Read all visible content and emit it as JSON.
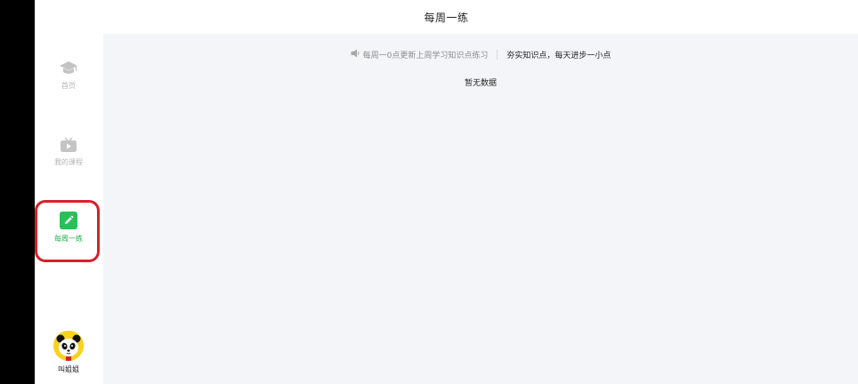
{
  "header": {
    "title": "每周一练"
  },
  "sidebar": {
    "items": [
      {
        "label": "首页",
        "icon": "graduation-cap-icon",
        "active": false
      },
      {
        "label": "我的课程",
        "icon": "tv-icon",
        "active": false
      },
      {
        "label": "每周一练",
        "icon": "pencil-icon",
        "active": true
      }
    ],
    "profile": {
      "name": "叫姐姐",
      "icon": "panda-avatar"
    }
  },
  "main": {
    "notice": {
      "text": "每周一0点更新上周学习知识点练习",
      "slogan": "夯实知识点，每天进步一小点"
    },
    "empty_text": "暂无数据"
  },
  "colors": {
    "accent": "#21b24a",
    "highlight_border": "#d6202a",
    "content_bg": "#f4f5f9",
    "avatar_bg": "#f7d21e"
  }
}
